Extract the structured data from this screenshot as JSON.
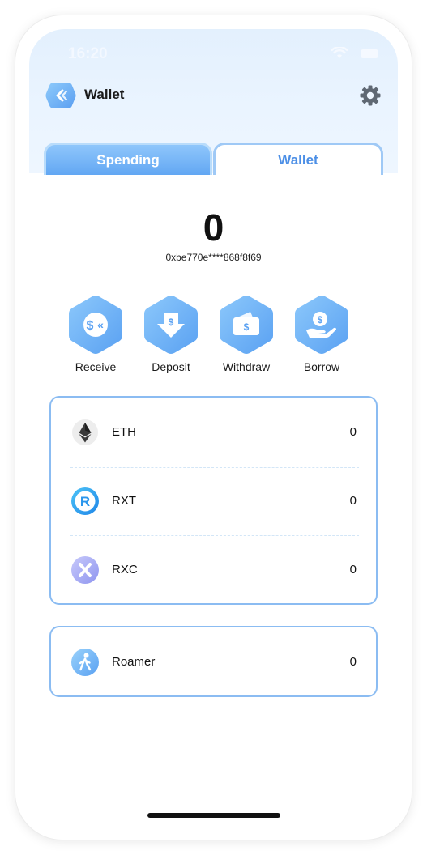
{
  "status_bar": {
    "time": "16:20"
  },
  "header": {
    "title": "Wallet",
    "settings_icon": "gear-icon",
    "logo_icon": "wallet-logo-icon"
  },
  "tabs": [
    {
      "label": "Spending",
      "active": false
    },
    {
      "label": "Wallet",
      "active": true
    }
  ],
  "balance": {
    "amount": "0",
    "address": "0xbe770e****868f8f69"
  },
  "actions": [
    {
      "label": "Receive",
      "icon": "receive-icon"
    },
    {
      "label": "Deposit",
      "icon": "deposit-icon"
    },
    {
      "label": "Withdraw",
      "icon": "withdraw-icon"
    },
    {
      "label": "Borrow",
      "icon": "borrow-icon"
    }
  ],
  "tokens": [
    {
      "name": "ETH",
      "value": "0",
      "icon": "eth-icon"
    },
    {
      "name": "RXT",
      "value": "0",
      "icon": "rxt-icon"
    },
    {
      "name": "RXC",
      "value": "0",
      "icon": "rxc-icon"
    }
  ],
  "nft": {
    "name": "Roamer",
    "value": "0",
    "icon": "roamer-icon"
  },
  "colors": {
    "accent": "#4c8fe6",
    "hex_icon_start": "#8cc8fb",
    "hex_icon_end": "#5aa1f2",
    "card_border": "#8bbcf2"
  }
}
